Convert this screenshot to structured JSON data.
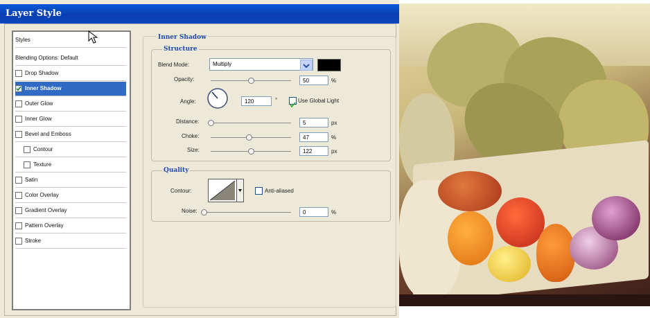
{
  "window": {
    "title": "Layer Style"
  },
  "styles_panel": {
    "items": [
      {
        "label": "Styles",
        "checkbox": false,
        "selected": false
      },
      {
        "label": "Blending Options: Default",
        "checkbox": false,
        "selected": false
      },
      {
        "label": "Drop Shadow",
        "checkbox": true,
        "checked": false,
        "selected": false
      },
      {
        "label": "Inner Shadow",
        "checkbox": true,
        "checked": true,
        "selected": true
      },
      {
        "label": "Outer Glow",
        "checkbox": true,
        "checked": false,
        "selected": false
      },
      {
        "label": "Inner Glow",
        "checkbox": true,
        "checked": false,
        "selected": false
      },
      {
        "label": "Bevel and Emboss",
        "checkbox": true,
        "checked": false,
        "selected": false
      },
      {
        "label": "Contour",
        "checkbox": true,
        "checked": false,
        "selected": false
      },
      {
        "label": "Texture",
        "checkbox": true,
        "checked": false,
        "selected": false
      },
      {
        "label": "Satin",
        "checkbox": true,
        "checked": false,
        "selected": false
      },
      {
        "label": "Color Overlay",
        "checkbox": true,
        "checked": false,
        "selected": false
      },
      {
        "label": "Gradient Overlay",
        "checkbox": true,
        "checked": false,
        "selected": false
      },
      {
        "label": "Pattern Overlay",
        "checkbox": true,
        "checked": false,
        "selected": false
      },
      {
        "label": "Stroke",
        "checkbox": true,
        "checked": false,
        "selected": false
      }
    ]
  },
  "inner_shadow": {
    "title": "Inner Shadow",
    "structure": {
      "title": "Structure",
      "blend_mode_label": "Blend Mode:",
      "blend_mode_value": "Multiply",
      "shadow_color": "#000000",
      "opacity_label": "Opacity:",
      "opacity_value": "50",
      "opacity_level": 0.5,
      "opacity_unit": "%",
      "angle_label": "Angle:",
      "angle_value": "120",
      "angle_unit": "°",
      "use_global_light_label": "Use Global Light",
      "use_global_light_checked": true,
      "distance_label": "Distance:",
      "distance_value": "5",
      "distance_level": 0.0,
      "distance_unit": "px",
      "choke_label": "Choke:",
      "choke_value": "47",
      "choke_level": 0.47,
      "choke_unit": "%",
      "size_label": "Size:",
      "size_value": "122",
      "size_level": 0.5,
      "size_unit": "px"
    },
    "quality": {
      "title": "Quality",
      "contour_label": "Contour:",
      "anti_aliased_label": "Anti-aliased",
      "anti_aliased_checked": false,
      "noise_label": "Noise:",
      "noise_value": "0",
      "noise_level": 0.0,
      "noise_unit": "%"
    }
  },
  "colors": {
    "titlebar": "#0a4fd0",
    "selection": "#316ac5",
    "dialog_bg": "#ece9d8",
    "section_header": "#2047a8"
  }
}
